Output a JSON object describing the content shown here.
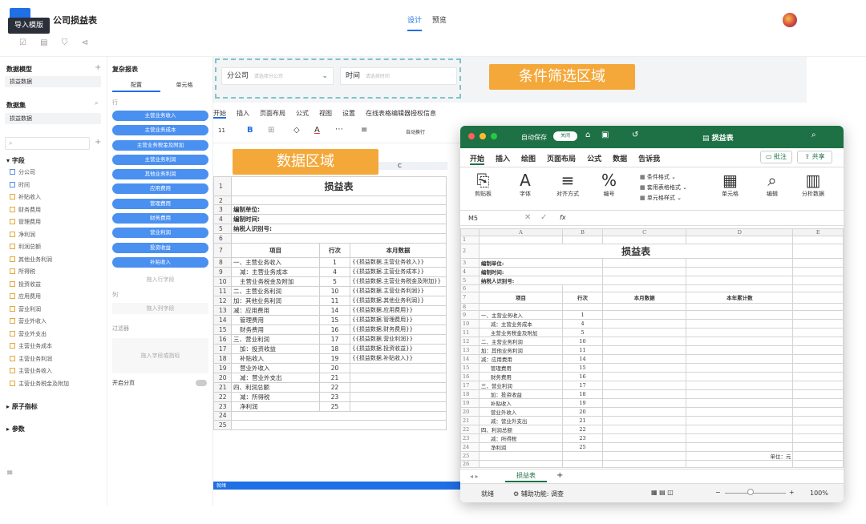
{
  "app": {
    "title": "公司损益表",
    "tooltip": "导入模版",
    "tabs": [
      "设计",
      "预览"
    ]
  },
  "left_panel": {
    "data_model_title": "数据模型",
    "data_model_item": "损益数据",
    "dataset_title": "数据集",
    "dataset_item": "损益数据",
    "fields_title": "字段",
    "fields": [
      "分公司",
      "时间",
      "补贴收入",
      "财务费用",
      "管理费用",
      "净利润",
      "利润总额",
      "其他业务利润",
      "所得税",
      "投资收益",
      "应用费用",
      "营业利润",
      "营业外收入",
      "营业外支出",
      "主营业务成本",
      "主营业务利润",
      "主营业务收入",
      "主营业务税金及附加"
    ],
    "atomic_title": "原子指标",
    "param_title": "参数"
  },
  "config_panel": {
    "title": "复杂报表",
    "tabs": [
      "配置",
      "单元格"
    ],
    "row_label": "行",
    "row_fields": [
      "主营业务收入",
      "主营业务成本",
      "主营业务税金及附加",
      "主营业务利润",
      "其他业务利润",
      "应用费用",
      "管理费用",
      "财务费用",
      "营业利润",
      "投资收益",
      "补贴收入"
    ],
    "add_row": "拖入行字段",
    "col_label": "列",
    "add_col": "拖入列字段",
    "filter_label": "过滤器",
    "add_filter": "拖入字段或指标",
    "paging_label": "开启分页"
  },
  "filters": {
    "company_label": "分公司",
    "company_placeholder": "请选择分公司",
    "time_label": "时间",
    "time_placeholder": "请选择时间"
  },
  "callouts": {
    "filter_area": "条件筛选区域",
    "data_area": "数据区域"
  },
  "ribbon": [
    "开始",
    "插入",
    "页面布局",
    "公式",
    "视图",
    "设置",
    "在线表格编辑器授权信息"
  ],
  "font_size": "11",
  "wrap_label": "自动换行",
  "sheet": {
    "col_c": "C",
    "title": "损益表",
    "info": [
      "编制单位:",
      "编制时间:",
      "纳税人识别号:"
    ],
    "headers": [
      "项目",
      "行次",
      "本月数据"
    ],
    "rows": [
      [
        "一、主营业务收入",
        "1",
        "{{损益数据.主营业务收入}}"
      ],
      [
        "减：主营业务成本",
        "4",
        "{{损益数据.主营业务成本}}"
      ],
      [
        "主营业务税金及附加",
        "5",
        "{{损益数据.主营业务税金及附加}}"
      ],
      [
        "二、主营业务利润",
        "10",
        "{{损益数据.主营业务利润}}"
      ],
      [
        "加：其他业务利润",
        "11",
        "{{损益数据.其他业务利润}}"
      ],
      [
        "减：应用费用",
        "14",
        "{{损益数据.应用费用}}"
      ],
      [
        "管理费用",
        "15",
        "{{损益数据.管理费用}}"
      ],
      [
        "财务费用",
        "16",
        "{{损益数据.财务费用}}"
      ],
      [
        "三、营业利润",
        "17",
        "{{损益数据.营业利润}}"
      ],
      [
        "加：投资收益",
        "18",
        "{{损益数据.投资收益}}"
      ],
      [
        "补贴收入",
        "19",
        "{{损益数据.补贴收入}}"
      ],
      [
        "营业外收入",
        "20",
        ""
      ],
      [
        "减：营业外支出",
        "21",
        ""
      ],
      [
        "四、利润总额",
        "22",
        ""
      ],
      [
        "减：所得税",
        "23",
        ""
      ],
      [
        "净利润",
        "25",
        ""
      ]
    ],
    "row_numbers": [
      "1",
      "2",
      "3",
      "4",
      "5",
      "6",
      "7",
      "8",
      "9",
      "10",
      "11",
      "12",
      "13",
      "14",
      "15",
      "16",
      "17",
      "18",
      "19",
      "20",
      "21",
      "22",
      "23",
      "24",
      "25"
    ],
    "status": "就绪"
  },
  "excel": {
    "autosave": "自动保存",
    "autosave_state": "关闭",
    "file": "损益表",
    "tabs": [
      "开始",
      "插入",
      "绘图",
      "页面布局",
      "公式",
      "数据",
      "告诉我"
    ],
    "comment": "批注",
    "share": "共享",
    "ribbon_groups": [
      "剪贴板",
      "字体",
      "对齐方式",
      "编号",
      "单元格",
      "编辑",
      "分析数据"
    ],
    "styles": [
      "条件格式",
      "套用表格格式",
      "单元格样式"
    ],
    "cell_ref": "M5",
    "fx": "fx",
    "col_heads": [
      "A",
      "B",
      "C",
      "D",
      "E"
    ],
    "title": "损益表",
    "info": [
      "编制单位:",
      "编制时间:",
      "纳税人识别号:"
    ],
    "headers": [
      "项目",
      "行次",
      "本月数据",
      "本年累计数"
    ],
    "rows": [
      [
        "一、主营业务收入",
        "1"
      ],
      [
        "减：主营业务成本",
        "4"
      ],
      [
        "主营业务税金及附加",
        "5"
      ],
      [
        "二、主营业务利润",
        "10"
      ],
      [
        "加：其他业务利润",
        "11"
      ],
      [
        "减：应用费用",
        "14"
      ],
      [
        "管理费用",
        "15"
      ],
      [
        "财务费用",
        "16"
      ],
      [
        "三、营业利润",
        "17"
      ],
      [
        "加：投资收益",
        "18"
      ],
      [
        "补贴收入",
        "19"
      ],
      [
        "营业外收入",
        "20"
      ],
      [
        "减：营业外支出",
        "21"
      ],
      [
        "四、利润总额",
        "22"
      ],
      [
        "减：所得税",
        "23"
      ],
      [
        "净利润",
        "25"
      ]
    ],
    "unit": "单位：元",
    "sheet_tab": "损益表",
    "status_ready": "就绪",
    "accessibility": "辅助功能: 调查",
    "zoom": "100%"
  },
  "colors": {
    "accent": "#1f6fe5",
    "pill": "#4a90f0",
    "callout": "#f4a83a",
    "excel_green": "#1e7145"
  }
}
